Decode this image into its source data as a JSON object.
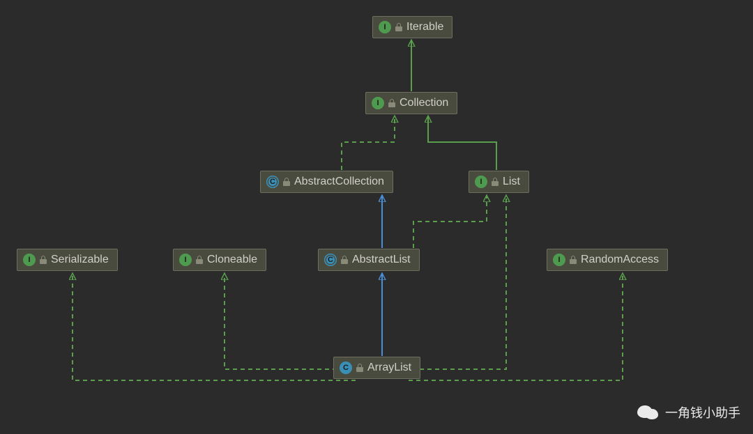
{
  "nodes": {
    "iterable": {
      "label": "Iterable",
      "type": "interface"
    },
    "collection": {
      "label": "Collection",
      "type": "interface"
    },
    "abstractCollection": {
      "label": "AbstractCollection",
      "type": "abstract-class"
    },
    "list": {
      "label": "List",
      "type": "interface"
    },
    "serializable": {
      "label": "Serializable",
      "type": "interface"
    },
    "cloneable": {
      "label": "Cloneable",
      "type": "interface"
    },
    "abstractList": {
      "label": "AbstractList",
      "type": "abstract-class"
    },
    "randomAccess": {
      "label": "RandomAccess",
      "type": "interface"
    },
    "arrayList": {
      "label": "ArrayList",
      "type": "class"
    }
  },
  "edges": [
    {
      "from": "collection",
      "to": "iterable",
      "style": "solid",
      "color": "green",
      "relation": "extends"
    },
    {
      "from": "abstractCollection",
      "to": "collection",
      "style": "dashed",
      "color": "green",
      "relation": "implements"
    },
    {
      "from": "list",
      "to": "collection",
      "style": "solid",
      "color": "green",
      "relation": "extends"
    },
    {
      "from": "abstractList",
      "to": "abstractCollection",
      "style": "solid",
      "color": "blue",
      "relation": "extends"
    },
    {
      "from": "abstractList",
      "to": "list",
      "style": "dashed",
      "color": "green",
      "relation": "implements"
    },
    {
      "from": "arrayList",
      "to": "abstractList",
      "style": "solid",
      "color": "blue",
      "relation": "extends"
    },
    {
      "from": "arrayList",
      "to": "serializable",
      "style": "dashed",
      "color": "green",
      "relation": "implements"
    },
    {
      "from": "arrayList",
      "to": "cloneable",
      "style": "dashed",
      "color": "green",
      "relation": "implements"
    },
    {
      "from": "arrayList",
      "to": "list",
      "style": "dashed",
      "color": "green",
      "relation": "implements"
    },
    {
      "from": "arrayList",
      "to": "randomAccess",
      "style": "dashed",
      "color": "green",
      "relation": "implements"
    }
  ],
  "colors": {
    "background": "#2b2b2b",
    "nodeFill": "#4a4b3f",
    "nodeBorder": "#6e6f5e",
    "text": "#d0d0c8",
    "interfaceBadge": "#4e9a4e",
    "classBadge": "#3a8fb7",
    "arrowGreen": "#5a9e4e",
    "arrowBlue": "#4a8fd6"
  },
  "watermark": {
    "text": "一角钱小助手"
  }
}
